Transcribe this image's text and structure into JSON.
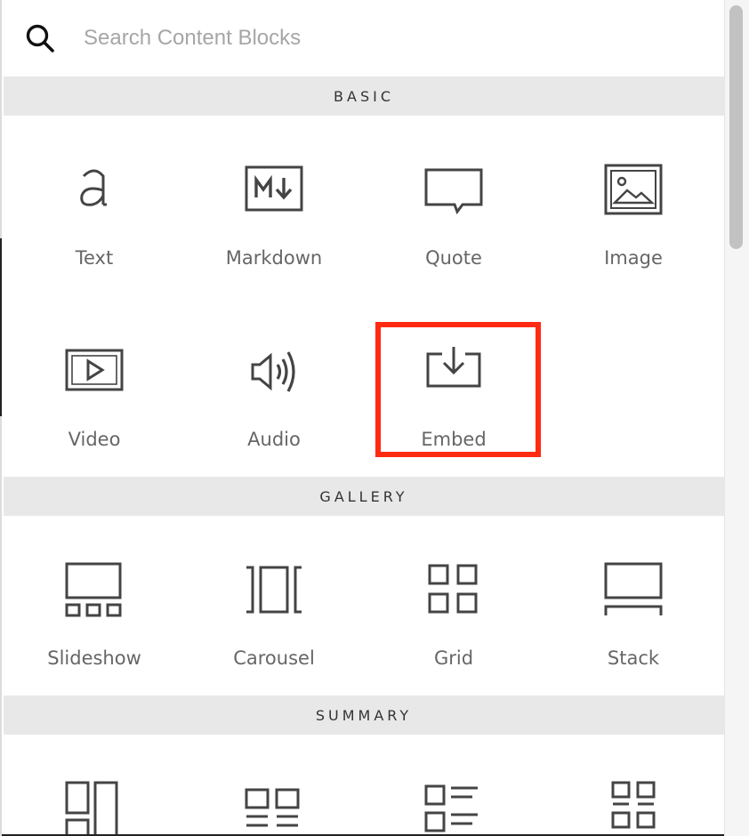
{
  "search": {
    "placeholder": "Search Content Blocks",
    "icon": "search-icon"
  },
  "sections": {
    "basic": {
      "title": "BASIC",
      "items": [
        {
          "label": "Text",
          "icon": "text-letter-a-icon"
        },
        {
          "label": "Markdown",
          "icon": "markdown-icon"
        },
        {
          "label": "Quote",
          "icon": "speech-bubble-icon"
        },
        {
          "label": "Image",
          "icon": "image-icon"
        },
        {
          "label": "Video",
          "icon": "video-play-icon"
        },
        {
          "label": "Audio",
          "icon": "speaker-icon"
        },
        {
          "label": "Embed",
          "icon": "embed-download-icon"
        }
      ]
    },
    "gallery": {
      "title": "GALLERY",
      "items": [
        {
          "label": "Slideshow",
          "icon": "slideshow-icon"
        },
        {
          "label": "Carousel",
          "icon": "carousel-icon"
        },
        {
          "label": "Grid",
          "icon": "grid-icon"
        },
        {
          "label": "Stack",
          "icon": "stack-icon"
        }
      ]
    },
    "summary": {
      "title": "SUMMARY",
      "items": [
        {
          "icon": "summary-wall-icon"
        },
        {
          "icon": "summary-carousel-icon"
        },
        {
          "icon": "summary-list-icon"
        },
        {
          "icon": "summary-grid-icon"
        }
      ]
    }
  },
  "colors": {
    "highlight": "#ff2a12",
    "section_header_bg": "#e8e8e8",
    "icon_stroke": "#444444"
  }
}
